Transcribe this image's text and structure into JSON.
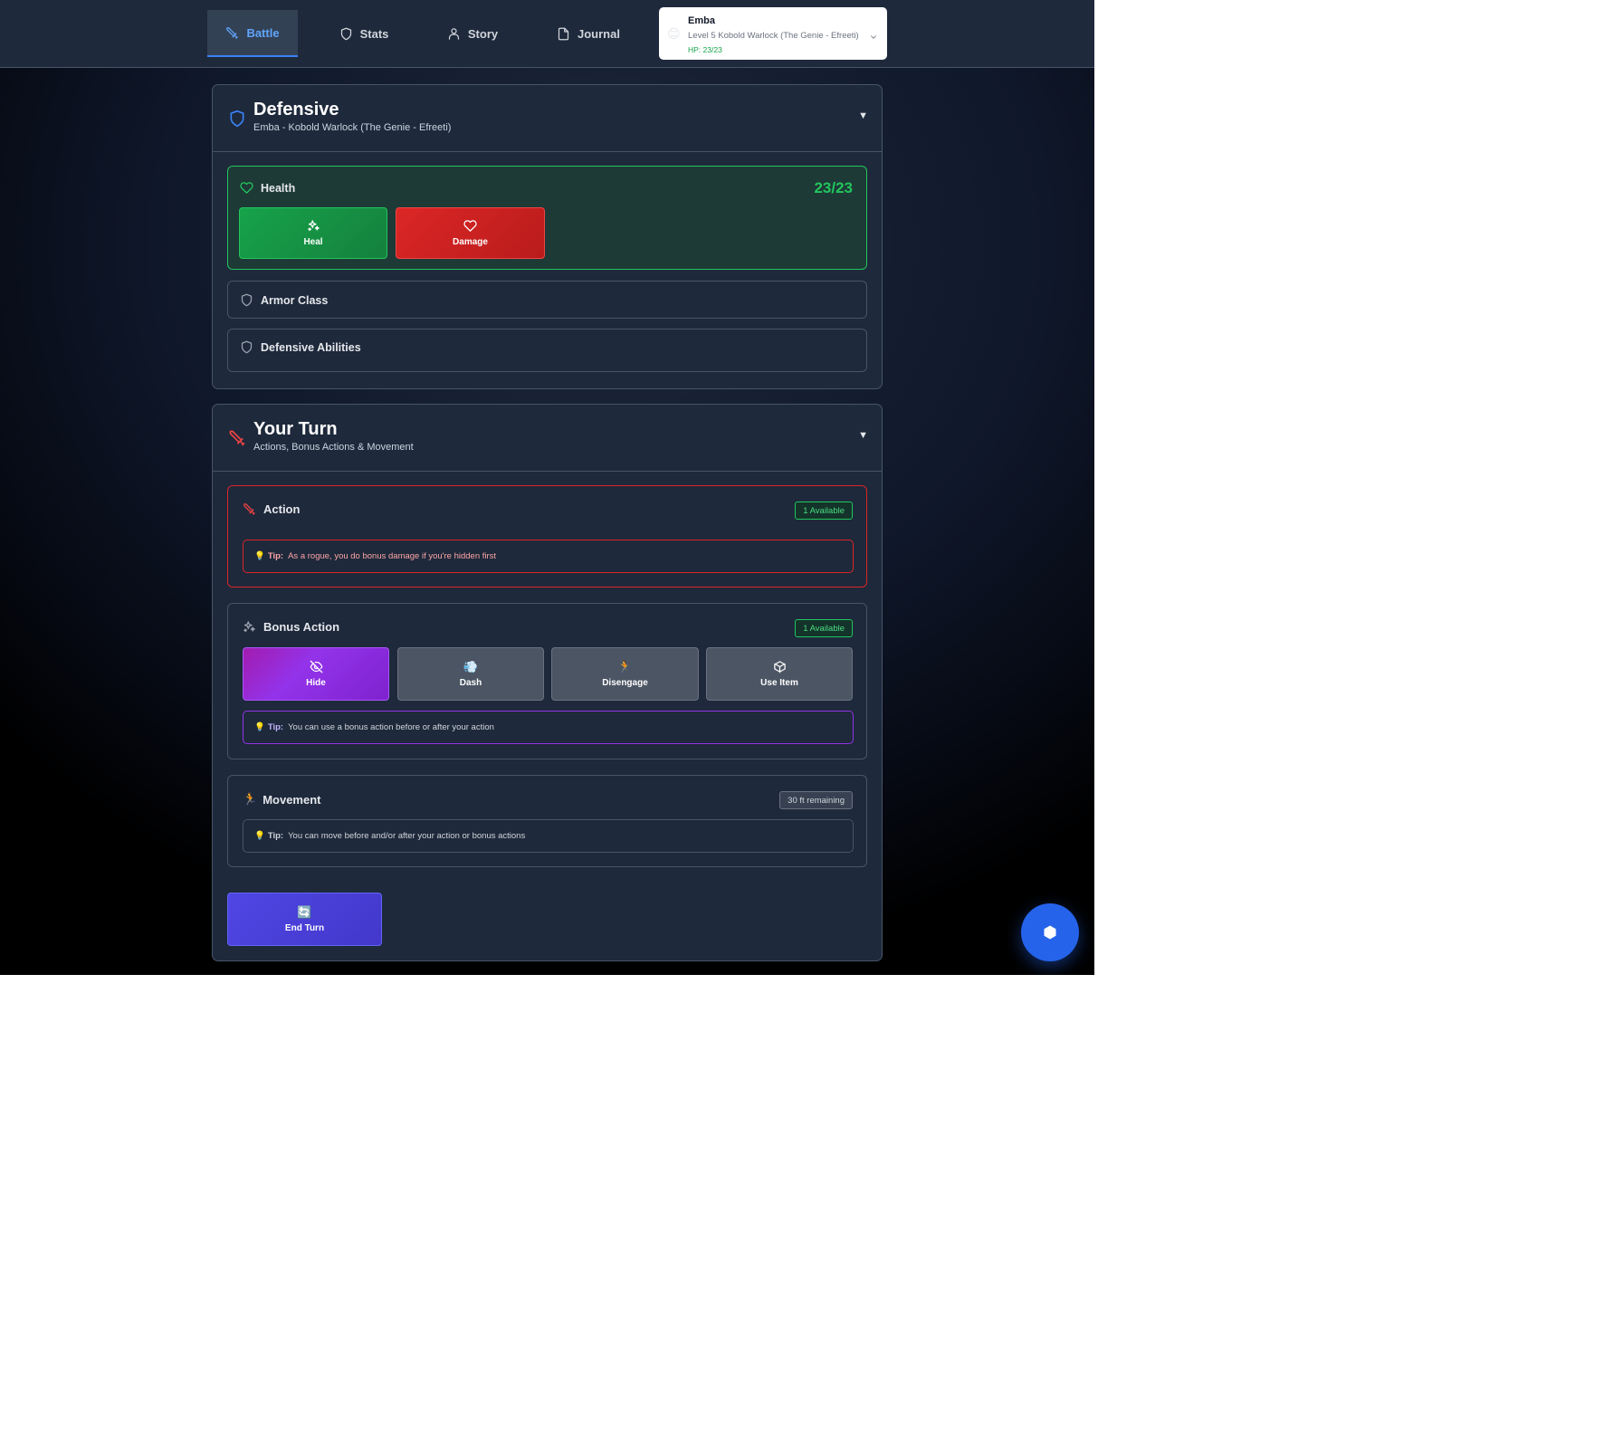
{
  "nav": {
    "tabs": [
      {
        "label": "Battle",
        "icon": "sword-icon",
        "active": true
      },
      {
        "label": "Stats",
        "icon": "shield-icon"
      },
      {
        "label": "Story",
        "icon": "user-icon"
      },
      {
        "label": "Journal",
        "icon": "file-icon"
      }
    ]
  },
  "character": {
    "emoji": "😊",
    "name": "Emba",
    "subtitle": "Level 5 Kobold Warlock (The Genie - Efreeti)",
    "hp": "HP: 23/23"
  },
  "defensive": {
    "title": "Defensive",
    "subtitle": "Emba - Kobold Warlock (The Genie - Efreeti)",
    "caret": "▼",
    "health": {
      "label": "Health",
      "value": "23/23",
      "heal_label": "Heal",
      "damage_label": "Damage"
    },
    "armor_class_label": "Armor Class",
    "abilities_label": "Defensive Abilities"
  },
  "turn": {
    "title": "Your Turn",
    "subtitle": "Actions, Bonus Actions & Movement",
    "caret": "▼",
    "action": {
      "label": "Action",
      "badge": "1 Available",
      "tip_prefix": "Tip:",
      "tip_text": "As a rogue, you do bonus damage if you're hidden first"
    },
    "bonus": {
      "label": "Bonus Action",
      "badge": "1 Available",
      "buttons": [
        {
          "label": "Hide",
          "icon": "eye-off-icon"
        },
        {
          "label": "Dash",
          "glyph": "💨"
        },
        {
          "label": "Disengage",
          "glyph": "🏃"
        },
        {
          "label": "Use Item",
          "icon": "box-icon"
        }
      ],
      "tip_prefix": "Tip:",
      "tip_text": "You can use a bonus action before or after your action"
    },
    "movement": {
      "glyph": "🏃",
      "label": "Movement",
      "badge": "30 ft remaining",
      "tip_prefix": "Tip:",
      "tip_text": "You can move before and/or after your action or bonus actions"
    },
    "end_turn": {
      "glyph": "🔄",
      "label": "End Turn"
    }
  },
  "tip_glyph": "💡",
  "colors": {
    "accent_blue": "#3b82f6",
    "health_green": "#22c55e",
    "danger_red": "#dc2626",
    "bonus_purple": "#9333ea",
    "end_turn_indigo": "#4f46e5"
  }
}
